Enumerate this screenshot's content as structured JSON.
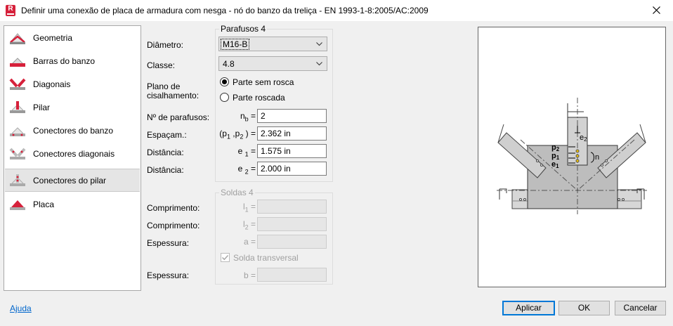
{
  "window": {
    "title": "Definir uma conexão de placa de armadura com nesga - nó do banzo da treliça - EN 1993-1-8:2005/AC:2009",
    "app_letter": "R"
  },
  "sidebar": {
    "items": [
      {
        "label": "Geometria",
        "icon": "geometry-icon"
      },
      {
        "label": "Barras do banzo",
        "icon": "chord-members-icon"
      },
      {
        "label": "Diagonais",
        "icon": "diagonals-icon"
      },
      {
        "label": "Pilar",
        "icon": "column-icon"
      },
      {
        "label": "Conectores do banzo",
        "icon": "chord-connectors-icon"
      },
      {
        "label": "Conectores diagonais",
        "icon": "diagonal-connectors-icon"
      },
      {
        "label": "Conectores do pilar",
        "icon": "column-connectors-icon",
        "selected": true
      },
      {
        "label": "Placa",
        "icon": "plate-icon"
      }
    ]
  },
  "bolts": {
    "group_title": "Parafusos 4",
    "diameter_label": "Diâmetro:",
    "diameter_value": "M16-B",
    "class_label": "Classe:",
    "class_value": "4.8",
    "shear_plane_label_1": "Plano de",
    "shear_plane_label_2": "cisalhamento:",
    "shear_option_1": "Parte sem rosca",
    "shear_option_2": "Parte roscada",
    "shear_selected": 1,
    "count_label": "Nº de parafusos:",
    "count_sym": "n",
    "count_sub": "b",
    "count_value": "2",
    "spacing_label": "Espaçam.:",
    "spacing_value": "2.362 in",
    "dist1_label": "Distância:",
    "dist1_sym": "e",
    "dist1_sub": "1",
    "dist1_value": "1.575 in",
    "dist2_label": "Distância:",
    "dist2_sym": "e",
    "dist2_sub": "2",
    "dist2_value": "2.000 in"
  },
  "welds": {
    "group_title": "Soldas 4",
    "length1_label": "Comprimento:",
    "length1_sym": "l",
    "length1_sub": "1",
    "length2_label": "Comprimento:",
    "length2_sym": "l",
    "length2_sub": "2",
    "thick1_label": "Espessura:",
    "thick1_sym": "a",
    "transverse_label": "Solda transversal",
    "transverse_checked": true,
    "thick2_label": "Espessura:",
    "thick2_sym": "b"
  },
  "preview": {
    "labels": {
      "e2": "e",
      "e2s": "2",
      "p2": "p",
      "p2s": "2",
      "p1": "p",
      "p1s": "1",
      "e1": "e",
      "e1s": "1",
      "n": "n"
    }
  },
  "footer": {
    "help_link": "Ajuda",
    "apply_label": "Aplicar",
    "ok_label": "OK",
    "cancel_label": "Cancelar"
  },
  "colors": {
    "accent": "#0078d7",
    "icon_red": "#d6213b"
  }
}
